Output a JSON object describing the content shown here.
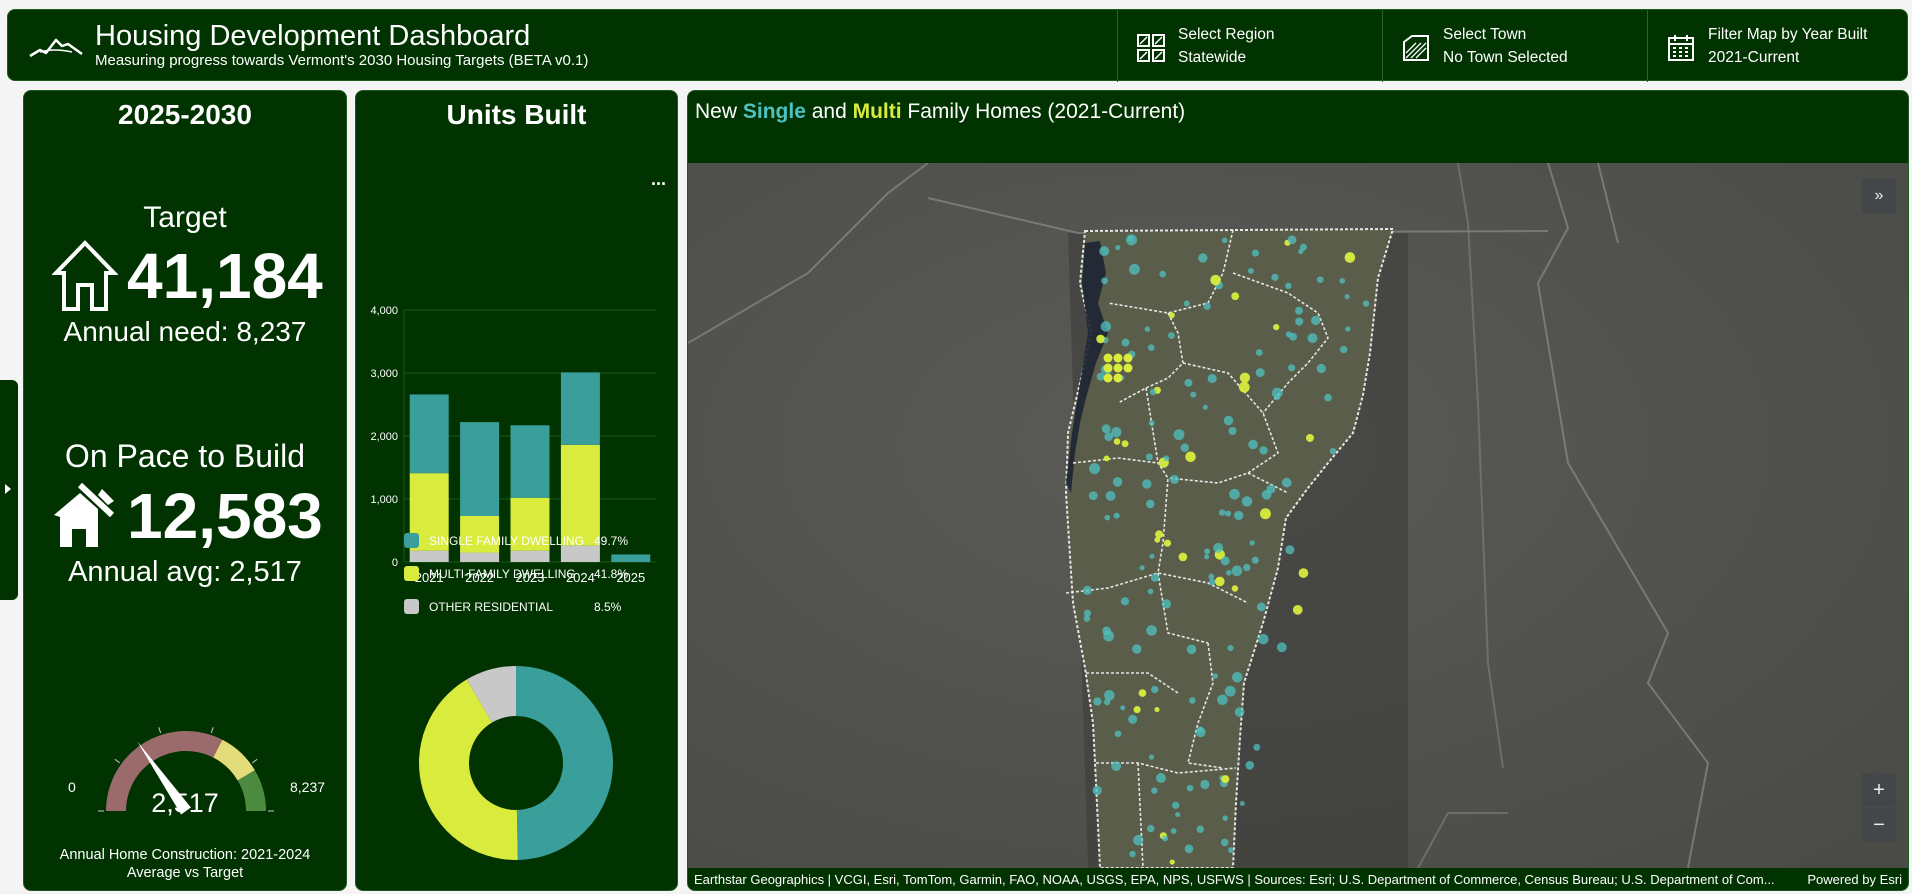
{
  "header": {
    "title": "Housing Development Dashboard",
    "subtitle": "Measuring progress towards Vermont's 2030 Housing Targets (BETA v0.1)",
    "selectors": [
      {
        "label": "Select Region",
        "value": "Statewide",
        "icon": "region-grid-icon"
      },
      {
        "label": "Select Town",
        "value": "No Town Selected",
        "icon": "town-map-icon"
      },
      {
        "label": "Filter Map by Year Built",
        "value": "2021-Current",
        "icon": "calendar-icon"
      }
    ]
  },
  "target_panel": {
    "period": "2025-2030",
    "target_label": "Target",
    "target_value": "41,184",
    "annual_need": "Annual need: 8,237",
    "pace_label": "On Pace to Build",
    "pace_value": "12,583",
    "annual_avg": "Annual avg: 2,517",
    "gauge": {
      "min_label": "0",
      "max_label": "8,237",
      "value_label": "2,517",
      "value": 2517,
      "max": 8237,
      "caption_line1": "Annual Home Construction: 2021-2024",
      "caption_line2": "Average vs Target"
    }
  },
  "units_panel": {
    "title": "Units Built",
    "menu": "...",
    "legend": [
      {
        "label": "SINGLE FAMILY DWELLING",
        "pct": "49.7%",
        "color": "#3a9e9a"
      },
      {
        "label": "MULTI-FAMILY DWELLING",
        "pct": "41.8%",
        "color": "#d9ec3e"
      },
      {
        "label": "OTHER RESIDENTIAL",
        "pct": "8.5%",
        "color": "#c8c8c8"
      }
    ]
  },
  "chart_data": [
    {
      "type": "bar",
      "stacked": true,
      "categories": [
        "2021",
        "2022",
        "2023",
        "2024",
        "2025"
      ],
      "series": [
        {
          "values": [
            180,
            150,
            180,
            260,
            0
          ],
          "color": "#c8c8c8"
        },
        {
          "values": [
            1230,
            580,
            840,
            1600,
            0
          ],
          "color": "#d9ec3e"
        },
        {
          "values": [
            1250,
            1490,
            1150,
            1150,
            120
          ],
          "color": "#3a9e9a"
        }
      ],
      "yticks": [
        "0",
        "1,000",
        "2,000",
        "3,000",
        "4,000"
      ],
      "ylim": [
        0,
        4000
      ],
      "grid": true
    },
    {
      "type": "pie",
      "donut": true,
      "labels": [
        "SINGLE FAMILY DWELLING",
        "MULTI-FAMILY DWELLING",
        "OTHER RESIDENTIAL"
      ],
      "values": [
        49.7,
        41.8,
        8.5
      ],
      "colors": [
        "#3a9e9a",
        "#d9ec3e",
        "#c8c8c8"
      ]
    }
  ],
  "map_panel": {
    "title_pre": "New ",
    "title_single": "Single",
    "title_mid": " and ",
    "title_multi": "Multi",
    "title_post": " Family Homes (2021-Current)",
    "single_color": "#4fc1c0",
    "multi_color": "#d9ec3e",
    "attribution": "Earthstar Geographics | VCGI, Esri, TomTom, Garmin, FAO, NOAA, USGS, EPA, NPS, USFWS | Sources: Esri; U.S. Department of Commerce, Census Bureau; U.S. Department of Com...",
    "powered_by": "Powered by Esri",
    "zoom_in": "+",
    "zoom_out": "−",
    "collapse": "»"
  }
}
